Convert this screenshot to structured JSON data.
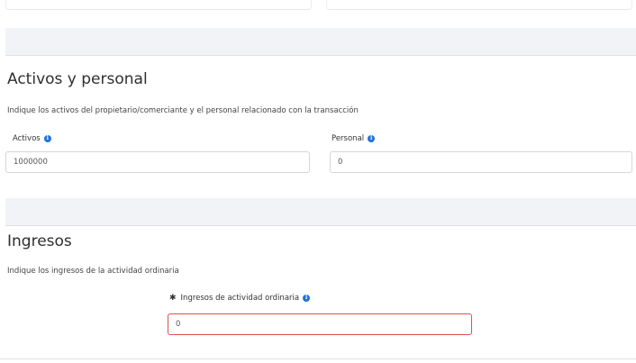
{
  "activos_personal": {
    "title": "Activos y personal",
    "description": "Indique los activos del propietario/comerciante y el personal relacionado con la transacción",
    "activos": {
      "label": "Activos",
      "value": "1000000"
    },
    "personal": {
      "label": "Personal",
      "value": "0"
    }
  },
  "ingresos": {
    "title": "Ingresos",
    "description": "Indique los ingresos de la actividad ordinaria",
    "ingresos_actividad": {
      "required_mark": "✱",
      "label": "Ingresos de actividad ordinaria",
      "value": "0"
    }
  },
  "icons": {
    "info": "info-icon"
  },
  "colors": {
    "info_icon": "#1f73d8",
    "error_border": "#d9534f",
    "band_background": "#f2f3f7"
  }
}
